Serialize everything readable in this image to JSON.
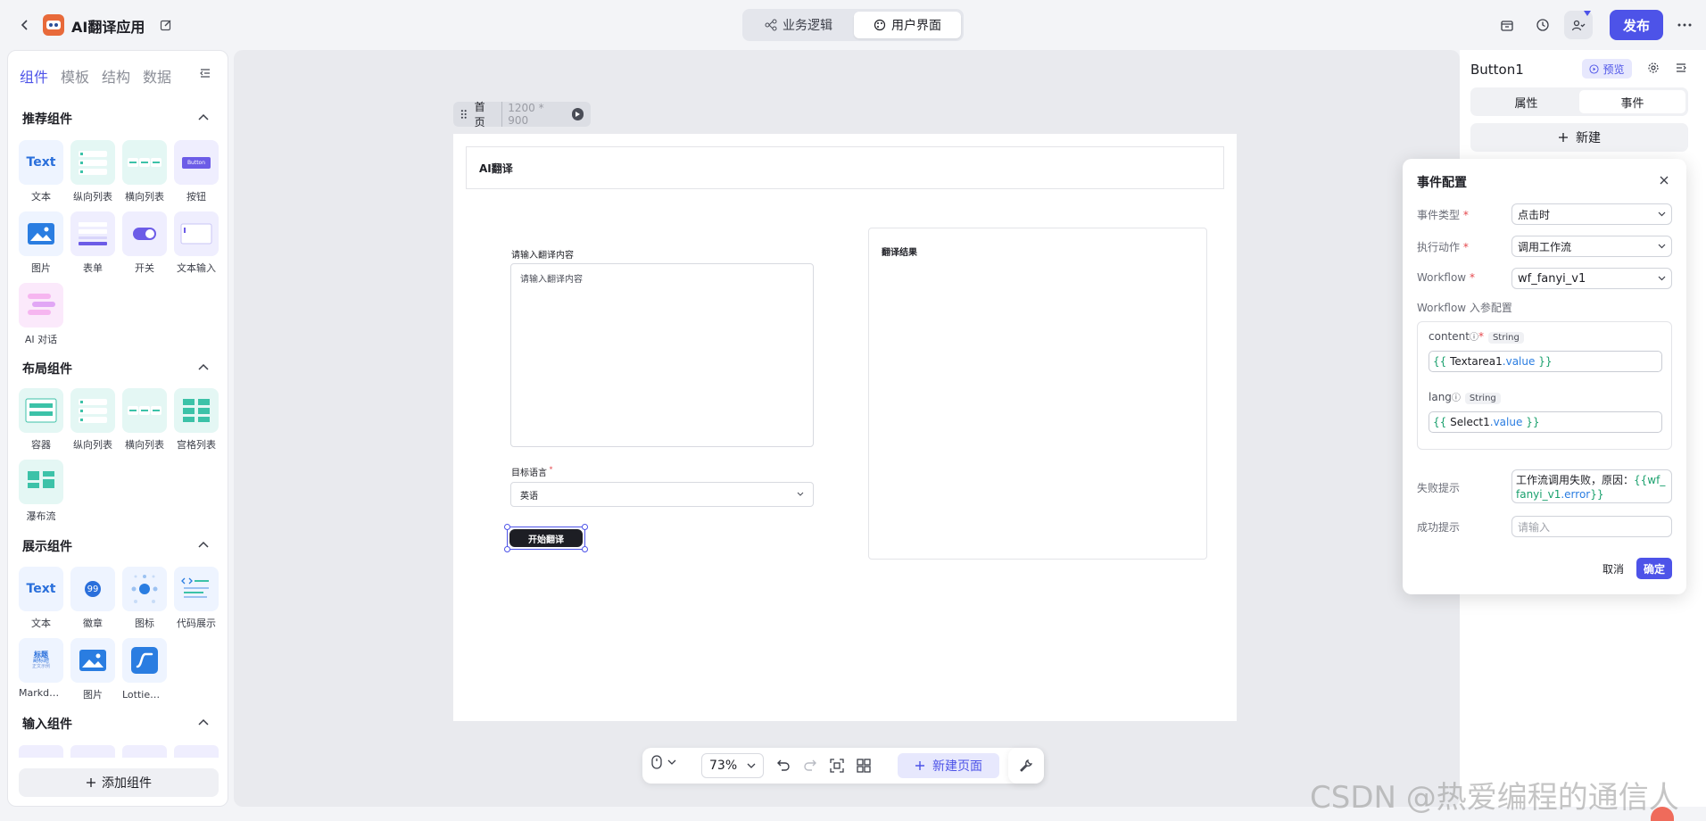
{
  "topbar": {
    "app_name": "AI翻译应用",
    "tabs": [
      "业务逻辑",
      "用户界面"
    ],
    "publish_label": "发布"
  },
  "left_panel": {
    "tabs": [
      "组件",
      "模板",
      "结构",
      "数据"
    ],
    "recommended": {
      "title": "推荐组件",
      "items": [
        "文本",
        "纵向列表",
        "横向列表",
        "按钮",
        "图片",
        "表单",
        "开关",
        "文本输入",
        "AI 对话"
      ]
    },
    "layout": {
      "title": "布局组件",
      "items": [
        "容器",
        "纵向列表",
        "横向列表",
        "宫格列表",
        "瀑布流"
      ]
    },
    "display": {
      "title": "展示组件",
      "items": [
        "文本",
        "徽章",
        "图标",
        "代码展示",
        "Markdo…",
        "图片",
        "Lottie动画"
      ]
    },
    "input": {
      "title": "输入组件"
    },
    "add_button": "添加组件",
    "thumb_text": "Text",
    "thumb_button": "Button",
    "badge_num": "99",
    "md_thumb": [
      "标题",
      "副标题",
      "正文示例"
    ]
  },
  "canvas": {
    "page_name": "首页",
    "page_size": "1200 * 900",
    "header_title": "AI翻译",
    "input_label": "请输入翻译内容",
    "input_placeholder": "请输入翻译内容",
    "lang_label": "目标语言",
    "lang_value": "英语",
    "button_label": "开始翻译",
    "result_label": "翻译结果"
  },
  "bottombar": {
    "zoom": "73%",
    "new_page": "新建页面"
  },
  "right_panel": {
    "component_name": "Button1",
    "preview_label": "预览",
    "tabs": [
      "属性",
      "事件"
    ],
    "new_label": "新建"
  },
  "event_config": {
    "title": "事件配置",
    "event_type_label": "事件类型",
    "event_type_value": "点击时",
    "action_label": "执行动作",
    "action_value": "调用工作流",
    "workflow_label": "Workflow",
    "workflow_value": "wf_fanyi_v1",
    "params_label": "Workflow 入参配置",
    "params": [
      {
        "name": "content",
        "type": "String",
        "open": "{{",
        "var": "Textarea1",
        "prop": ".value",
        "close": "}}"
      },
      {
        "name": "lang",
        "type": "String",
        "open": "{{",
        "var": "Select1",
        "prop": ".value",
        "close": "}}"
      }
    ],
    "fail_label": "失败提示",
    "fail_text": "工作流调用失败，原因：",
    "fail_expr_open": "{{wf_fa",
    "fail_expr_rest": "nyi_v1",
    "fail_expr_prop": ".error",
    "fail_expr_close": "}}",
    "success_label": "成功提示",
    "success_placeholder": "请输入",
    "cancel": "取消",
    "confirm": "确定"
  },
  "watermark": "CSDN @热爱编程的通信人",
  "colors": {
    "accent": "#4d53e8",
    "page_bg": "#f3f4f7",
    "canvas_bg": "#e9eaee"
  }
}
